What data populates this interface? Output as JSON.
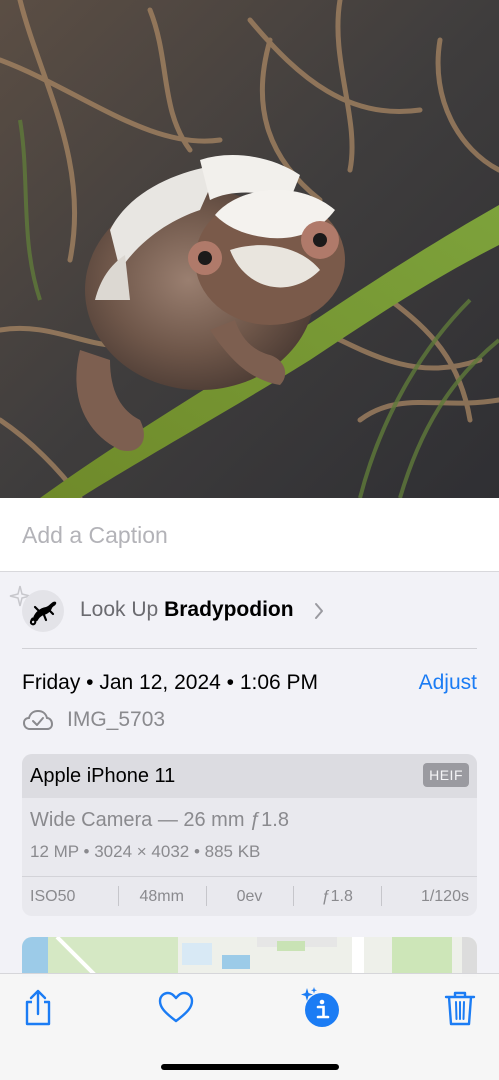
{
  "photo": {
    "subject": "chameleon-photo"
  },
  "caption": {
    "placeholder": "Add a Caption",
    "value": ""
  },
  "lookup": {
    "prefix": "Look Up ",
    "term": "Bradypodion"
  },
  "info": {
    "date": "Friday • Jan 12, 2024 • 1:06 PM",
    "adjust_label": "Adjust",
    "filename": "IMG_5703"
  },
  "camera": {
    "device": "Apple iPhone 11",
    "format_badge": "HEIF",
    "lens": "Wide Camera — 26 mm ƒ1.8",
    "specs": "12 MP  •  3024 × 4032  •  885 KB",
    "exif": {
      "iso": "ISO50",
      "focal": "48mm",
      "ev": "0ev",
      "aperture": "ƒ1.8",
      "shutter": "1/120s"
    }
  },
  "toolbar": {
    "icons": [
      "share-icon",
      "heart-icon",
      "info-sparkle-icon",
      "trash-icon"
    ]
  },
  "colors": {
    "accent": "#1b7cf4",
    "background": "#f2f2f7"
  }
}
